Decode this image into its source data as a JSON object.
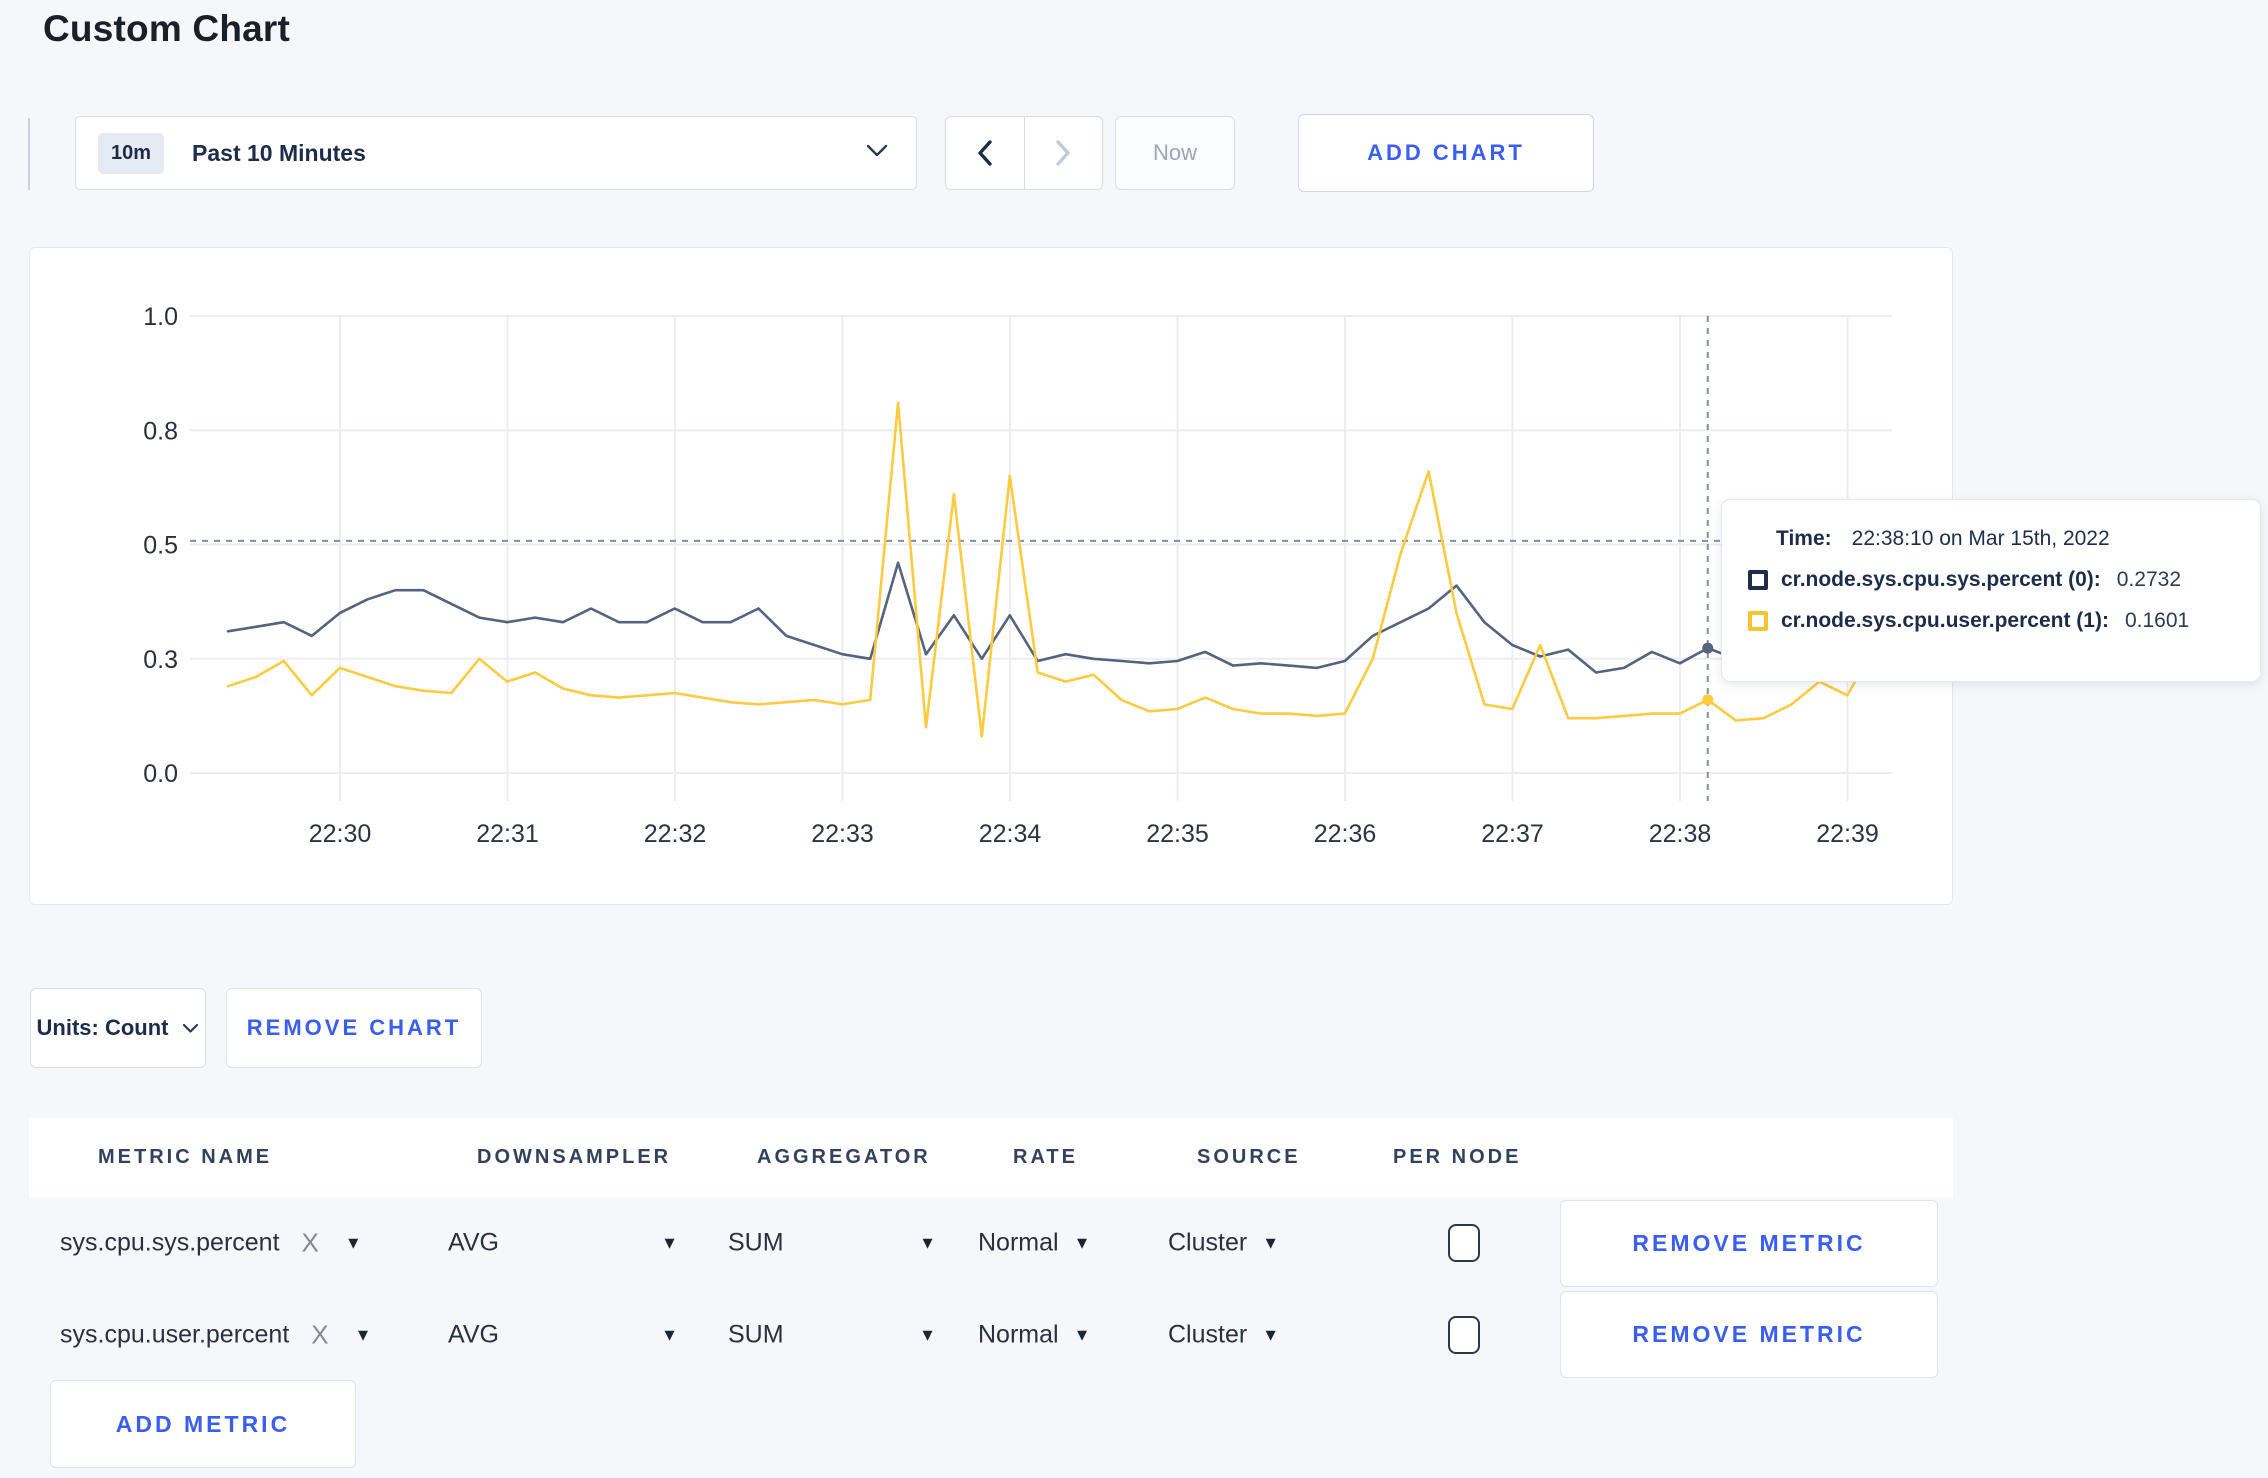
{
  "page": {
    "title": "Custom Chart"
  },
  "toolbar": {
    "range_badge": "10m",
    "range_label": "Past 10 Minutes",
    "prev_icon": "chevron-left",
    "next_icon": "chevron-right",
    "now_label": "Now",
    "add_chart_label": "ADD CHART"
  },
  "chart_data": {
    "type": "line",
    "title": "",
    "xlabel": "",
    "ylabel": "",
    "ylim": [
      0,
      1
    ],
    "grid": true,
    "x_start_label": "22:29:20",
    "interval_seconds": 10,
    "x_ticks": [
      "22:30",
      "22:31",
      "22:32",
      "22:33",
      "22:34",
      "22:35",
      "22:36",
      "22:37",
      "22:38",
      "22:39"
    ],
    "y_ticks": [
      {
        "label": "0.0",
        "value": 0
      },
      {
        "label": "0.3",
        "value": 0.25
      },
      {
        "label": "0.5",
        "value": 0.5
      },
      {
        "label": "0.8",
        "value": 0.75
      },
      {
        "label": "1.0",
        "value": 1.0
      }
    ],
    "series": [
      {
        "name": "cr.node.sys.cpu.sys.percent",
        "color": "#55637f",
        "values": [
          0.31,
          0.32,
          0.33,
          0.3,
          0.35,
          0.38,
          0.4,
          0.4,
          0.37,
          0.34,
          0.33,
          0.34,
          0.33,
          0.36,
          0.33,
          0.33,
          0.36,
          0.33,
          0.33,
          0.36,
          0.3,
          0.28,
          0.26,
          0.25,
          0.46,
          0.26,
          0.345,
          0.25,
          0.345,
          0.245,
          0.26,
          0.25,
          0.245,
          0.24,
          0.245,
          0.265,
          0.235,
          0.24,
          0.235,
          0.23,
          0.245,
          0.3,
          0.33,
          0.36,
          0.41,
          0.33,
          0.28,
          0.255,
          0.27,
          0.22,
          0.23,
          0.265,
          0.24,
          0.2732,
          0.25,
          0.26,
          0.26,
          0.27,
          0.29,
          0.31
        ]
      },
      {
        "name": "cr.node.sys.cpu.user.percent",
        "color": "#fdca40",
        "values": [
          0.19,
          0.21,
          0.245,
          0.17,
          0.23,
          0.21,
          0.19,
          0.18,
          0.175,
          0.25,
          0.2,
          0.22,
          0.185,
          0.17,
          0.165,
          0.17,
          0.175,
          0.165,
          0.155,
          0.15,
          0.155,
          0.16,
          0.15,
          0.16,
          0.81,
          0.1,
          0.61,
          0.08,
          0.65,
          0.22,
          0.2,
          0.215,
          0.16,
          0.135,
          0.14,
          0.165,
          0.14,
          0.13,
          0.13,
          0.125,
          0.13,
          0.25,
          0.48,
          0.66,
          0.35,
          0.15,
          0.14,
          0.28,
          0.12,
          0.12,
          0.125,
          0.13,
          0.13,
          0.1601,
          0.115,
          0.12,
          0.15,
          0.2,
          0.17,
          0.28
        ]
      }
    ],
    "hover": {
      "index": 53,
      "crosshair_value": 0.508,
      "time": "22:38:10"
    },
    "legend_position": "tooltip"
  },
  "tooltip": {
    "time_label": "Time:",
    "time_value": "22:38:10 on Mar 15th, 2022",
    "rows": [
      {
        "name": "cr.node.sys.cpu.sys.percent (0):",
        "value": "0.2732",
        "color": "#1f2c4f"
      },
      {
        "name": "cr.node.sys.cpu.user.percent (1):",
        "value": "0.1601",
        "color": "#f8c32e"
      }
    ]
  },
  "units": {
    "label": "Units: Count",
    "remove_chart_label": "REMOVE CHART"
  },
  "metrics": {
    "headers": [
      "METRIC NAME",
      "DOWNSAMPLER",
      "AGGREGATOR",
      "RATE",
      "SOURCE",
      "PER NODE"
    ],
    "rows": [
      {
        "name": "sys.cpu.sys.percent",
        "clear_icon": "X",
        "downsampler": "AVG",
        "aggregator": "SUM",
        "rate": "Normal",
        "source": "Cluster",
        "per_node_checked": false,
        "remove_label": "REMOVE METRIC"
      },
      {
        "name": "sys.cpu.user.percent",
        "clear_icon": "X",
        "downsampler": "AVG",
        "aggregator": "SUM",
        "rate": "Normal",
        "source": "Cluster",
        "per_node_checked": false,
        "remove_label": "REMOVE METRIC"
      }
    ],
    "add_metric_label": "ADD METRIC"
  },
  "colors": {
    "accent_blue": "#3a5ef2",
    "navy_text": "#1e2b49",
    "page_bg": "#f6f7fa",
    "gridline": "#ebedf1",
    "crosshair": "#7d90a8"
  }
}
